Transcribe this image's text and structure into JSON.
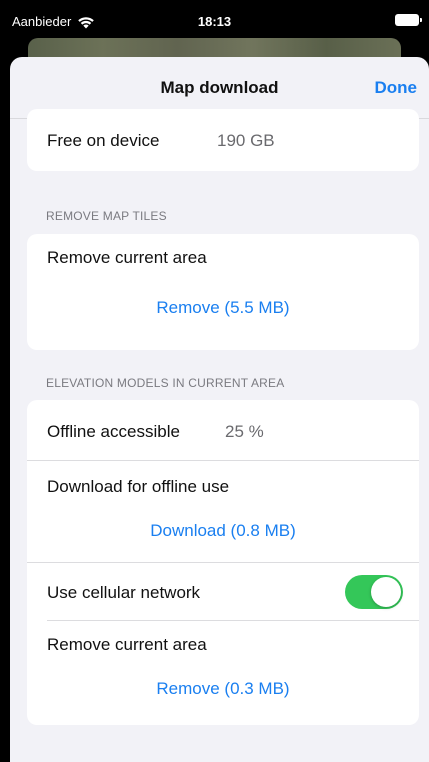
{
  "status_bar": {
    "carrier": "Aanbieder",
    "time": "18:13"
  },
  "nav": {
    "title": "Map download",
    "done_label": "Done"
  },
  "storage": {
    "free_label": "Free on device",
    "free_value": "190 GB"
  },
  "remove_tiles": {
    "header": "REMOVE MAP TILES",
    "label": "Remove current area",
    "action": "Remove (5.5 MB)"
  },
  "elevation": {
    "header": "ELEVATION MODELS IN CURRENT AREA",
    "offline_label": "Offline accessible",
    "offline_value": "25 %",
    "download_label": "Download for offline use",
    "download_action": "Download (0.8 MB)",
    "cellular_label": "Use cellular network",
    "cellular_on": true,
    "remove_label": "Remove current area",
    "remove_action": "Remove (0.3 MB)"
  },
  "colors": {
    "accent": "#1a7ff0",
    "toggle_on": "#34c759",
    "background": "#f2f2f7"
  }
}
